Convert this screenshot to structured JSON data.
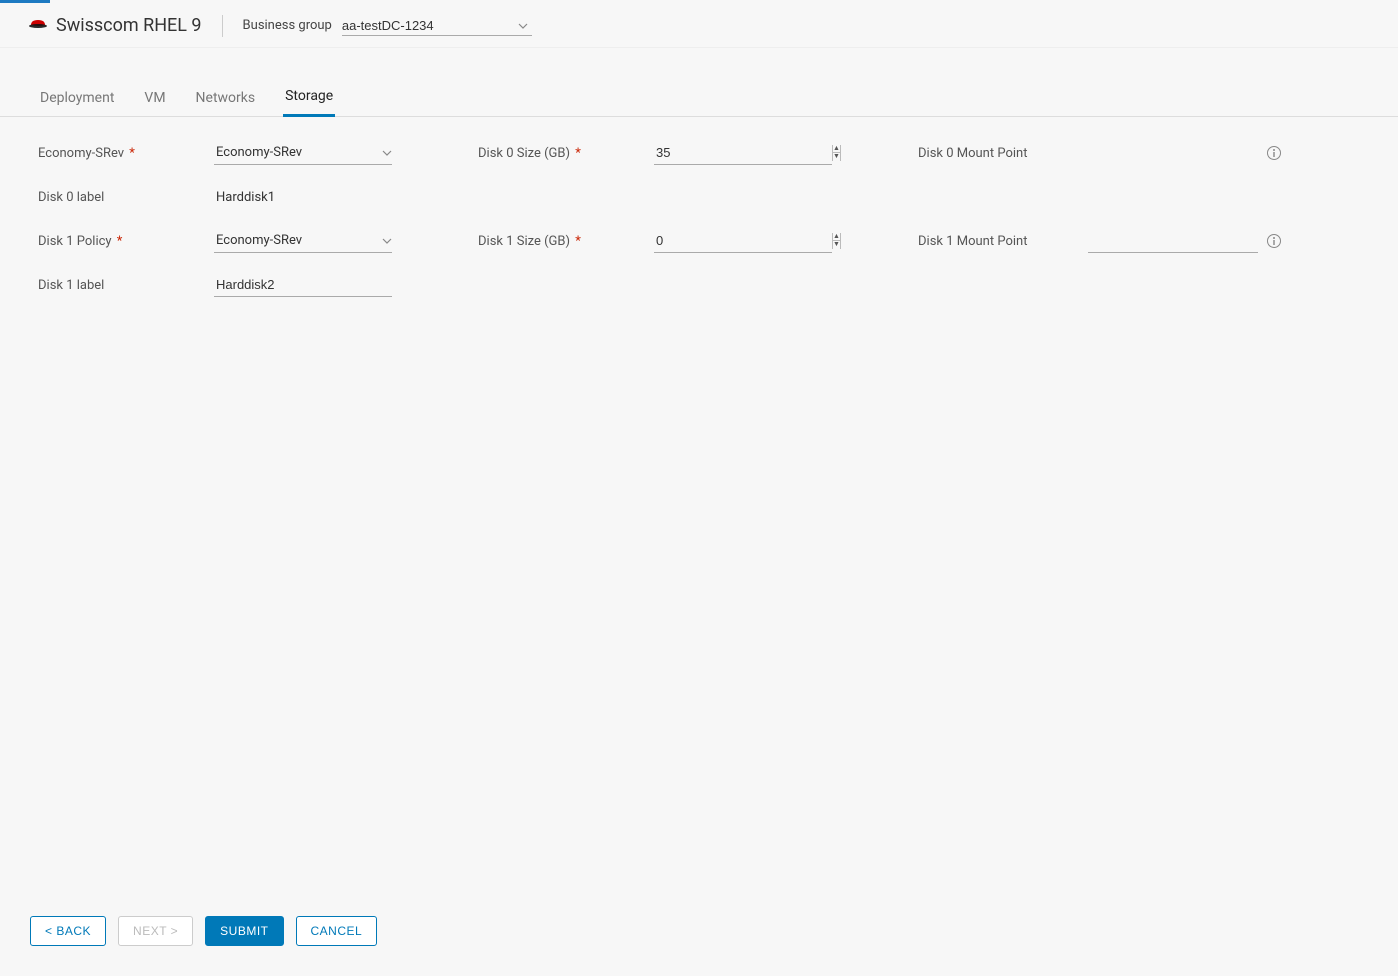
{
  "header": {
    "title": "Swisscom RHEL 9",
    "business_group_label": "Business group",
    "business_group_value": "aa-testDC-1234"
  },
  "tabs": [
    "Deployment",
    "VM",
    "Networks",
    "Storage"
  ],
  "active_tab_index": 3,
  "form": {
    "row1": {
      "policy_label": "Economy-SRev",
      "policy_value": "Economy-SRev",
      "size_label": "Disk 0 Size (GB)",
      "size_value": "35",
      "mount_label": "Disk 0 Mount Point",
      "mount_value": ""
    },
    "row2": {
      "label": "Disk 0 label",
      "value": "Harddisk1"
    },
    "row3": {
      "policy_label": "Disk 1 Policy",
      "policy_value": "Economy-SRev",
      "size_label": "Disk 1 Size (GB)",
      "size_value": "0",
      "mount_label": "Disk 1 Mount Point",
      "mount_value": ""
    },
    "row4": {
      "label": "Disk 1 label",
      "value": "Harddisk2"
    }
  },
  "footer": {
    "back": "< BACK",
    "next": "NEXT >",
    "submit": "SUBMIT",
    "cancel": "CANCEL"
  },
  "required_marker": "*"
}
